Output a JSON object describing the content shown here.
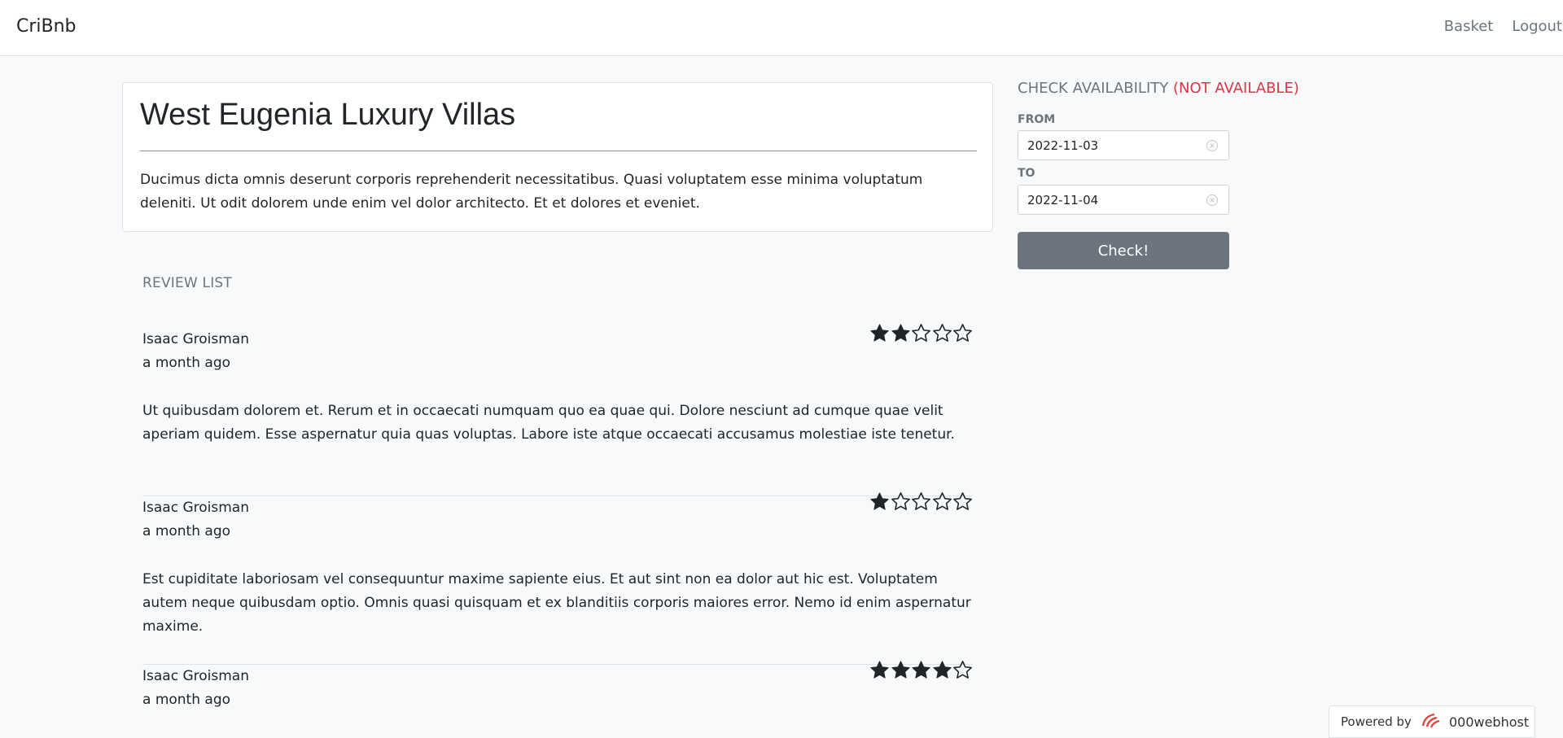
{
  "navbar": {
    "brand": "CriBnb",
    "links": [
      "Basket",
      "Logout"
    ]
  },
  "listing": {
    "title": "West Eugenia Luxury Villas",
    "description": "Ducimus dicta omnis deserunt corporis reprehenderit necessitatibus. Quasi voluptatem esse minima voluptatum deleniti. Ut odit dolorem unde enim vel dolor architecto. Et et dolores et eveniet."
  },
  "reviews": {
    "heading": "REVIEW LIST",
    "items": [
      {
        "author": "Isaac Groisman",
        "date": "a month ago",
        "rating": 2,
        "max_rating": 5,
        "text": "Ut quibusdam dolorem et. Rerum et in occaecati numquam quo ea quae qui. Dolore nesciunt ad cumque quae velit aperiam quidem. Esse aspernatur quia quas voluptas. Labore iste atque occaecati accusamus molestiae iste tenetur."
      },
      {
        "author": "Isaac Groisman",
        "date": "a month ago",
        "rating": 1,
        "max_rating": 5,
        "text": "Est cupiditate laboriosam vel consequuntur maxime sapiente eius. Et aut sint non ea dolor aut hic est. Voluptatem autem neque quibusdam optio. Omnis quasi quisquam et ex blanditiis corporis maiores error. Nemo id enim aspernatur maxime."
      },
      {
        "author": "Isaac Groisman",
        "date": "a month ago",
        "rating": 4,
        "max_rating": 5,
        "text": ""
      }
    ]
  },
  "availability": {
    "heading": "CHECK AVAILABILITY",
    "status": "(NOT AVAILABLE)",
    "status_color": "#dc3545",
    "from_label": "FROM",
    "from_value": "2022-11-03",
    "to_label": "TO",
    "to_value": "2022-11-04",
    "button_label": "Check!"
  },
  "footer_badge": {
    "prefix": "Powered by",
    "host": "000webhost"
  },
  "icons": {
    "star_filled": "star-filled-icon",
    "star_empty": "star-empty-icon",
    "clear": "clear-icon",
    "host_logo": "webhost-logo-icon"
  }
}
